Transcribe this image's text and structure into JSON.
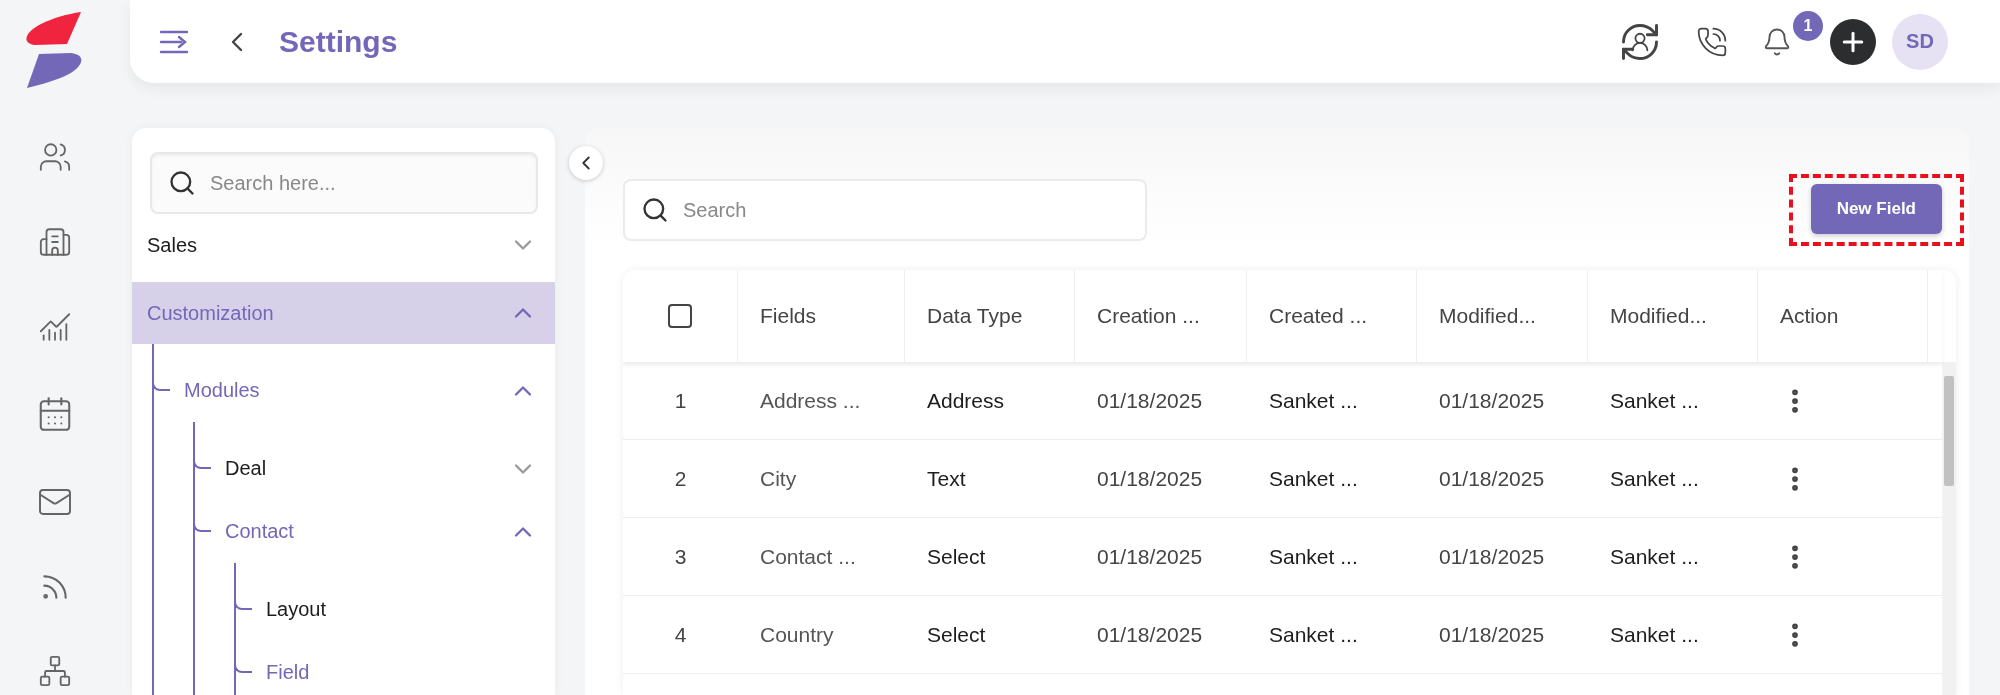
{
  "header": {
    "title": "Settings",
    "notification_count": "1",
    "avatar_initials": "SD"
  },
  "settings_nav": {
    "search": {
      "placeholder": "Search here..."
    },
    "items": [
      {
        "label": "Sales",
        "expanded": false,
        "selected": false
      },
      {
        "label": "Customization",
        "expanded": true,
        "selected": true,
        "children": [
          {
            "label": "Modules",
            "expanded": true,
            "selected": false,
            "children": [
              {
                "label": "Deal",
                "expanded": false,
                "selected": false
              },
              {
                "label": "Contact",
                "expanded": true,
                "selected": false,
                "children": [
                  {
                    "label": "Layout",
                    "selected": false
                  },
                  {
                    "label": "Field",
                    "selected": true
                  }
                ]
              }
            ]
          }
        ]
      }
    ]
  },
  "toolbar": {
    "search": {
      "placeholder": "Search"
    },
    "new_button": {
      "label": "New Field",
      "highlighted": true
    }
  },
  "table": {
    "select_all": {
      "checked": false
    },
    "columns": [
      "Fields",
      "Data Type",
      "Creation ...",
      "Created ...",
      "Modified...",
      "Modified...",
      "Action"
    ],
    "rows": [
      {
        "number": "1",
        "field": "Address ...",
        "data_type": "Address",
        "created_on": "01/18/2025",
        "created_by": "Sanket ...",
        "modified_on": "01/18/2025",
        "modified_by": "Sanket ..."
      },
      {
        "number": "2",
        "field": "City",
        "data_type": "Text",
        "created_on": "01/18/2025",
        "created_by": "Sanket ...",
        "modified_on": "01/18/2025",
        "modified_by": "Sanket ..."
      },
      {
        "number": "3",
        "field": "Contact ...",
        "data_type": "Select",
        "created_on": "01/18/2025",
        "created_by": "Sanket ...",
        "modified_on": "01/18/2025",
        "modified_by": "Sanket ..."
      },
      {
        "number": "4",
        "field": "Country",
        "data_type": "Select",
        "created_on": "01/18/2025",
        "created_by": "Sanket ...",
        "modified_on": "01/18/2025",
        "modified_by": "Sanket ..."
      }
    ]
  }
}
